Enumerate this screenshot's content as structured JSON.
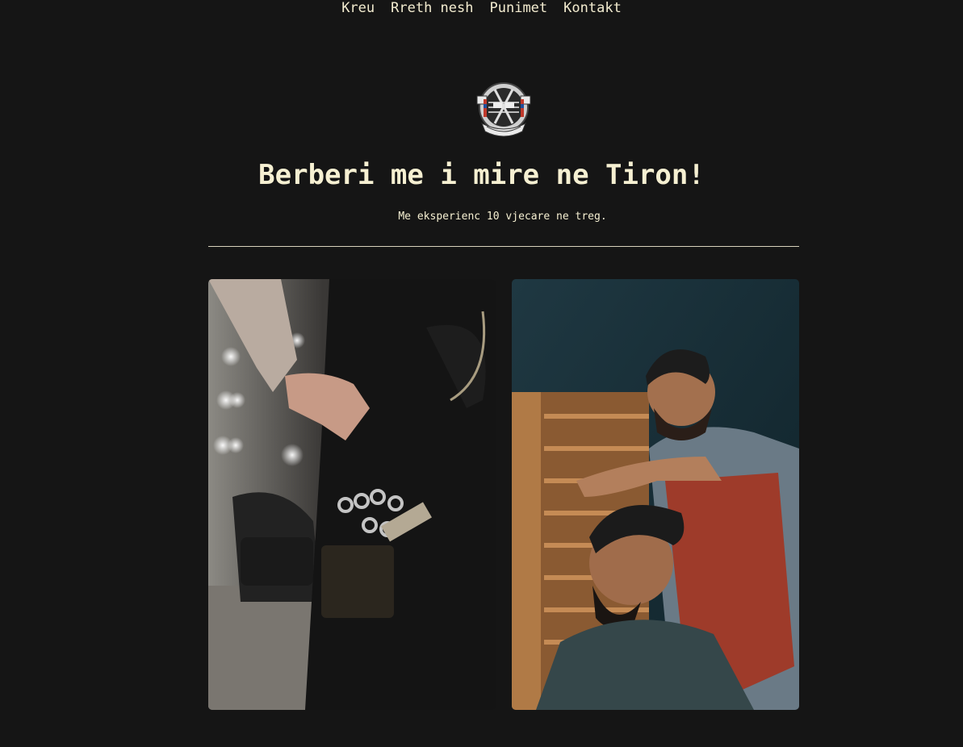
{
  "nav": {
    "items": [
      {
        "label": "Kreu"
      },
      {
        "label": "Rreth nesh"
      },
      {
        "label": "Punimet"
      },
      {
        "label": "Kontakt"
      }
    ]
  },
  "logo": {
    "icon": "barber-shop-logo",
    "label_left": "DONT",
    "label_right": "CUT",
    "banner": "BARBER SHOP"
  },
  "hero": {
    "title": "Berberi me i mire ne Tiron!",
    "subtitle": "Me eksperienc 10 vjecare ne treg."
  },
  "gallery": {
    "images": [
      {
        "icon": "barber-tools-photo"
      },
      {
        "icon": "haircut-photo"
      }
    ]
  },
  "colors": {
    "background": "#151515",
    "text": "#f3ecd0"
  }
}
